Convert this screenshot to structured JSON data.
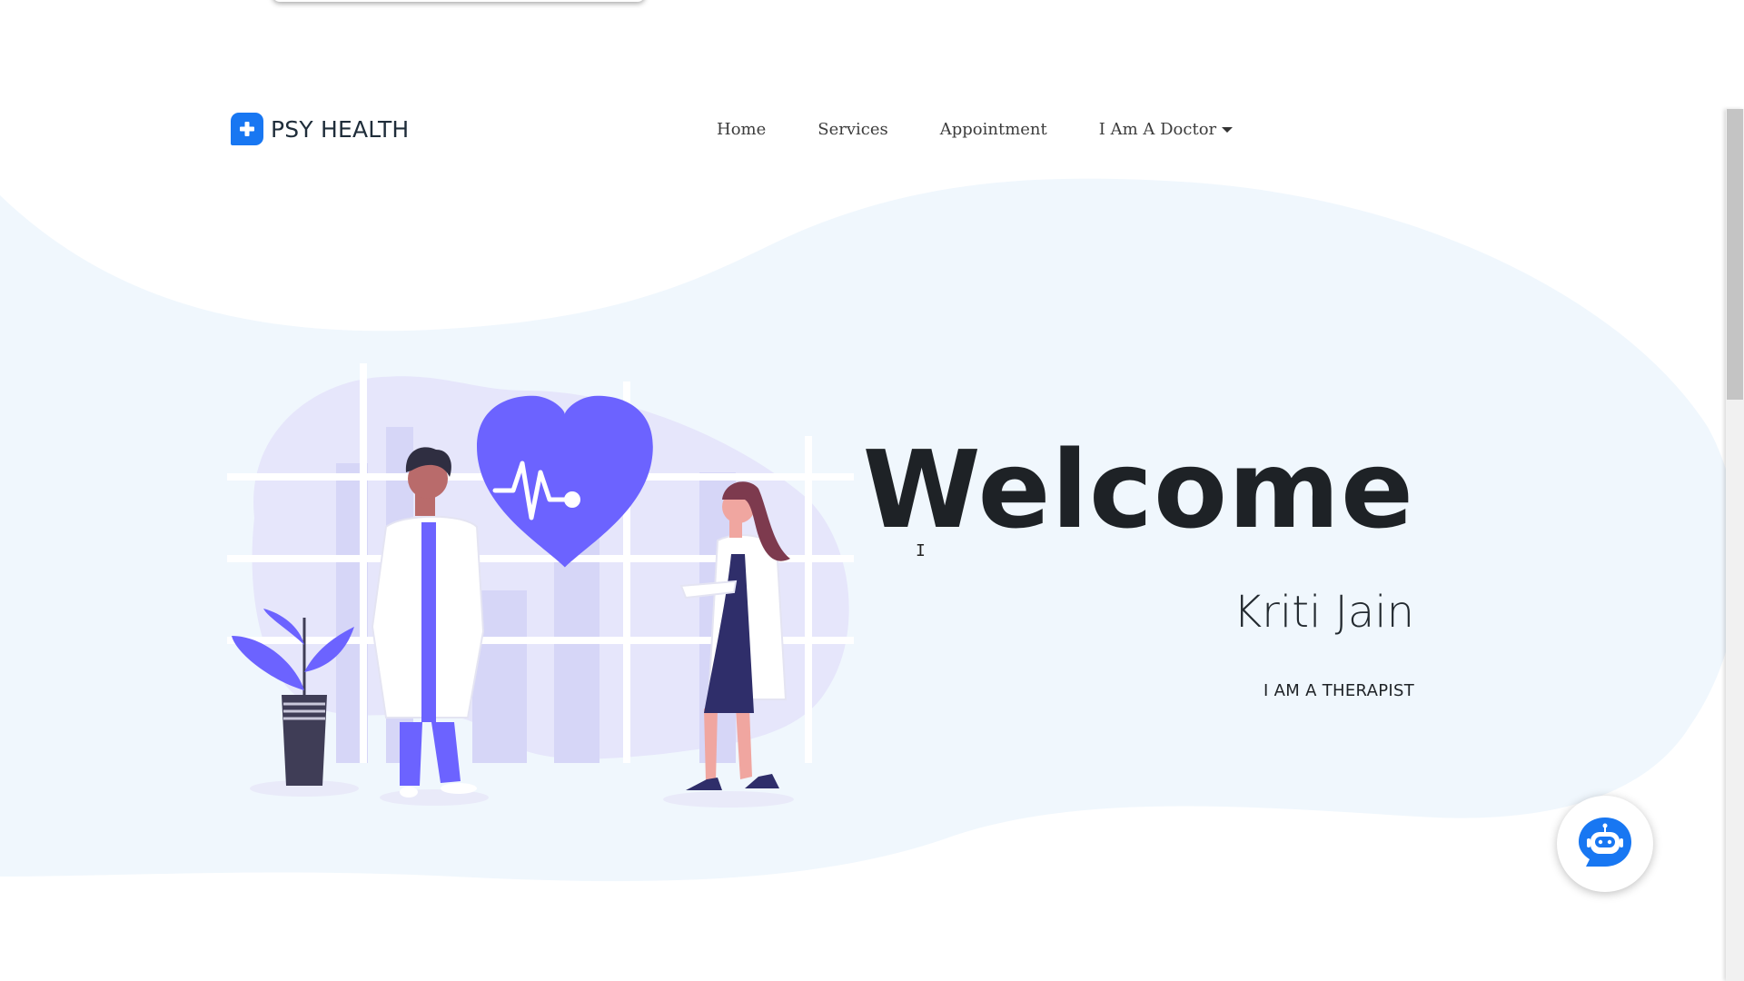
{
  "brand": {
    "name": "PSY HEALTH",
    "logo_icon": "plus-icon",
    "logo_color": "#1877f2"
  },
  "nav": {
    "items": [
      {
        "label": "Home"
      },
      {
        "label": "Services"
      },
      {
        "label": "Appointment"
      },
      {
        "label": "I Am A Doctor",
        "dropdown": true
      }
    ]
  },
  "hero": {
    "heading": "Welcome",
    "name": "Kriti Jain",
    "role": "I AM A THERAPIST",
    "illustration": "doctors-heart-illustration",
    "accent_color": "#6c63ff",
    "background_blob_color": "#f0f7fd"
  },
  "chatbot": {
    "icon": "robot-chat-icon",
    "color": "#1877f2"
  }
}
